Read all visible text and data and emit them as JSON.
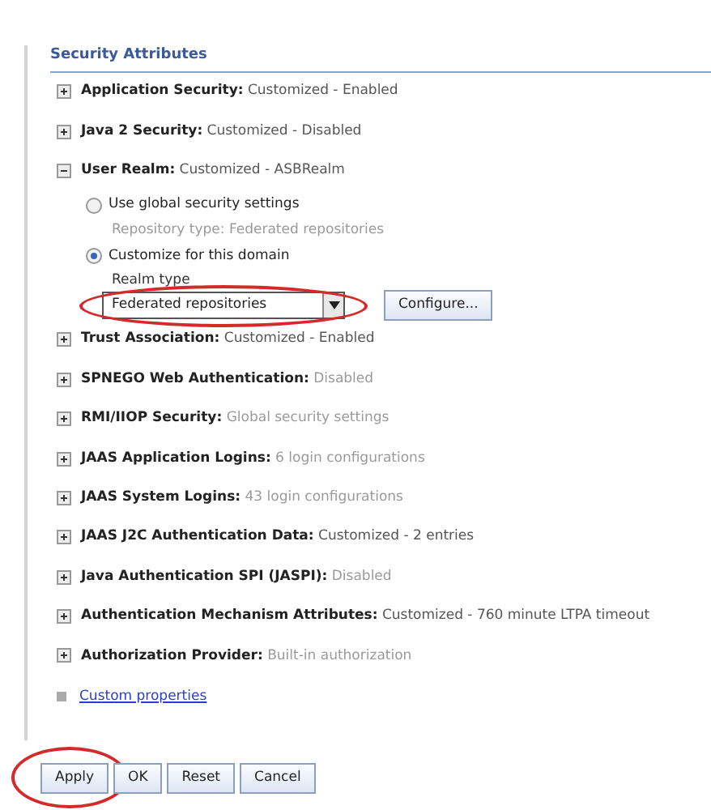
{
  "section": {
    "title": "Security Attributes"
  },
  "items": [
    {
      "label": "Application Security:",
      "value": "Customized - Enabled",
      "dimmed": false,
      "expanded": false
    },
    {
      "label": "Java 2 Security:",
      "value": "Customized - Disabled",
      "dimmed": false,
      "expanded": false
    },
    {
      "label": "User Realm:",
      "value": "Customized - ASBRealm",
      "dimmed": false,
      "expanded": true,
      "options": [
        {
          "label": "Use global security settings",
          "selected": false,
          "note": "Repository type: Federated repositories"
        },
        {
          "label": "Customize for this domain",
          "selected": true,
          "field": {
            "label": "Realm type",
            "value": "Federated repositories",
            "highlighted": true
          },
          "button": "Configure..."
        }
      ]
    },
    {
      "label": "Trust Association:",
      "value": "Customized - Enabled",
      "dimmed": false,
      "expanded": false
    },
    {
      "label": "SPNEGO Web Authentication:",
      "value": "Disabled",
      "dimmed": true,
      "expanded": false
    },
    {
      "label": "RMI/IIOP Security:",
      "value": "Global security settings",
      "dimmed": true,
      "expanded": false
    },
    {
      "label": "JAAS Application Logins:",
      "value": "6 login configurations",
      "dimmed": true,
      "expanded": false
    },
    {
      "label": "JAAS System Logins:",
      "value": "43 login configurations",
      "dimmed": true,
      "expanded": false
    },
    {
      "label": "JAAS J2C Authentication Data:",
      "value": "Customized - 2 entries",
      "dimmed": false,
      "expanded": false
    },
    {
      "label": "Java Authentication SPI (JASPI):",
      "value": "Disabled",
      "dimmed": true,
      "expanded": false
    },
    {
      "label": "Authentication Mechanism Attributes:",
      "value": "Customized - 760 minute LTPA timeout",
      "dimmed": false,
      "expanded": false
    },
    {
      "label": "Authorization Provider:",
      "value": "Built-in authorization",
      "dimmed": true,
      "expanded": false
    }
  ],
  "custom_properties": {
    "label": "Custom properties"
  },
  "buttons": [
    {
      "label": "Apply",
      "highlighted": true
    },
    {
      "label": "OK",
      "highlighted": false
    },
    {
      "label": "Reset",
      "highlighted": false
    },
    {
      "label": "Cancel",
      "highlighted": false
    }
  ]
}
